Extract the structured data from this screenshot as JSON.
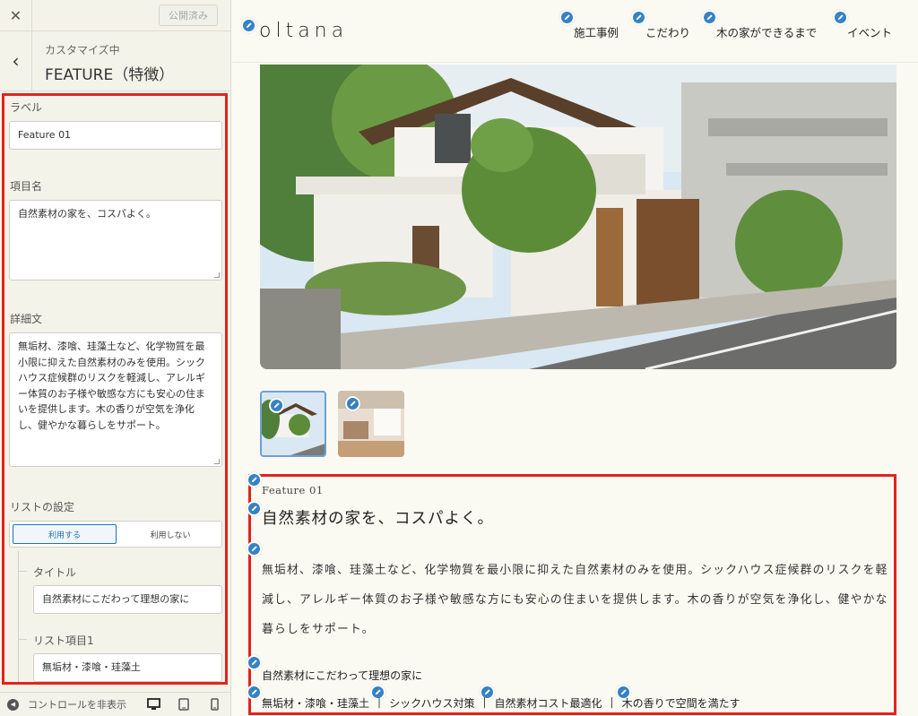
{
  "sidebar": {
    "close_icon": "close-icon",
    "publish_label": "公開済み",
    "back_icon": "chevron-left-icon",
    "customizing_label": "カスタマイズ中",
    "section_title": "FEATURE（特徴）",
    "fields": {
      "label_heading": "ラベル",
      "label_value": "Feature 01",
      "item_name_heading": "項目名",
      "item_name_value": "自然素材の家を、コスパよく。",
      "detail_heading": "詳細文",
      "detail_value": "無垢材、漆喰、珪藻土など、化学物質を最小限に抑えた自然素材のみを使用。シックハウス症候群のリスクを軽減し、アレルギー体質のお子様や敏感な方にも安心の住まいを提供します。木の香りが空気を浄化し、健やかな暮らしをサポート。",
      "list_settings_heading": "リストの設定",
      "use_label": "利用する",
      "not_use_label": "利用しない",
      "title_heading": "タイトル",
      "title_value": "自然素材にこだわって理想の家に",
      "list_item1_heading": "リスト項目1",
      "list_item1_value": "無垢材・漆喰・珪藻土"
    },
    "bottom": {
      "hide_controls_label": "コントロールを非表示",
      "devices": [
        "desktop-icon",
        "tablet-icon",
        "mobile-icon"
      ]
    }
  },
  "preview": {
    "logo": "oltana",
    "nav": [
      "施工事例",
      "こだわり",
      "木の家ができるまで",
      "イベント"
    ],
    "feature": {
      "label": "Feature 01",
      "title": "自然素材の家を、コスパよく。",
      "description": "無垢材、漆喰、珪藻土など、化学物質を最小限に抑えた自然素材のみを使用。シックハウス症候群のリスクを軽減し、アレルギー体質のお子様や敏感な方にも安心の住まいを提供します。木の香りが空気を浄化し、健やかな暮らしをサポート。",
      "list_title": "自然素材にこだわって理想の家に",
      "list_items": [
        "無垢材・漆喰・珪藻土",
        "シックハウス対策",
        "自然素材コスト最適化",
        "木の香りで空間を満たす"
      ]
    }
  },
  "colors": {
    "highlight": "#e2241c",
    "edit_pen": "#3582c4",
    "toggle_active": "#2271b1"
  }
}
